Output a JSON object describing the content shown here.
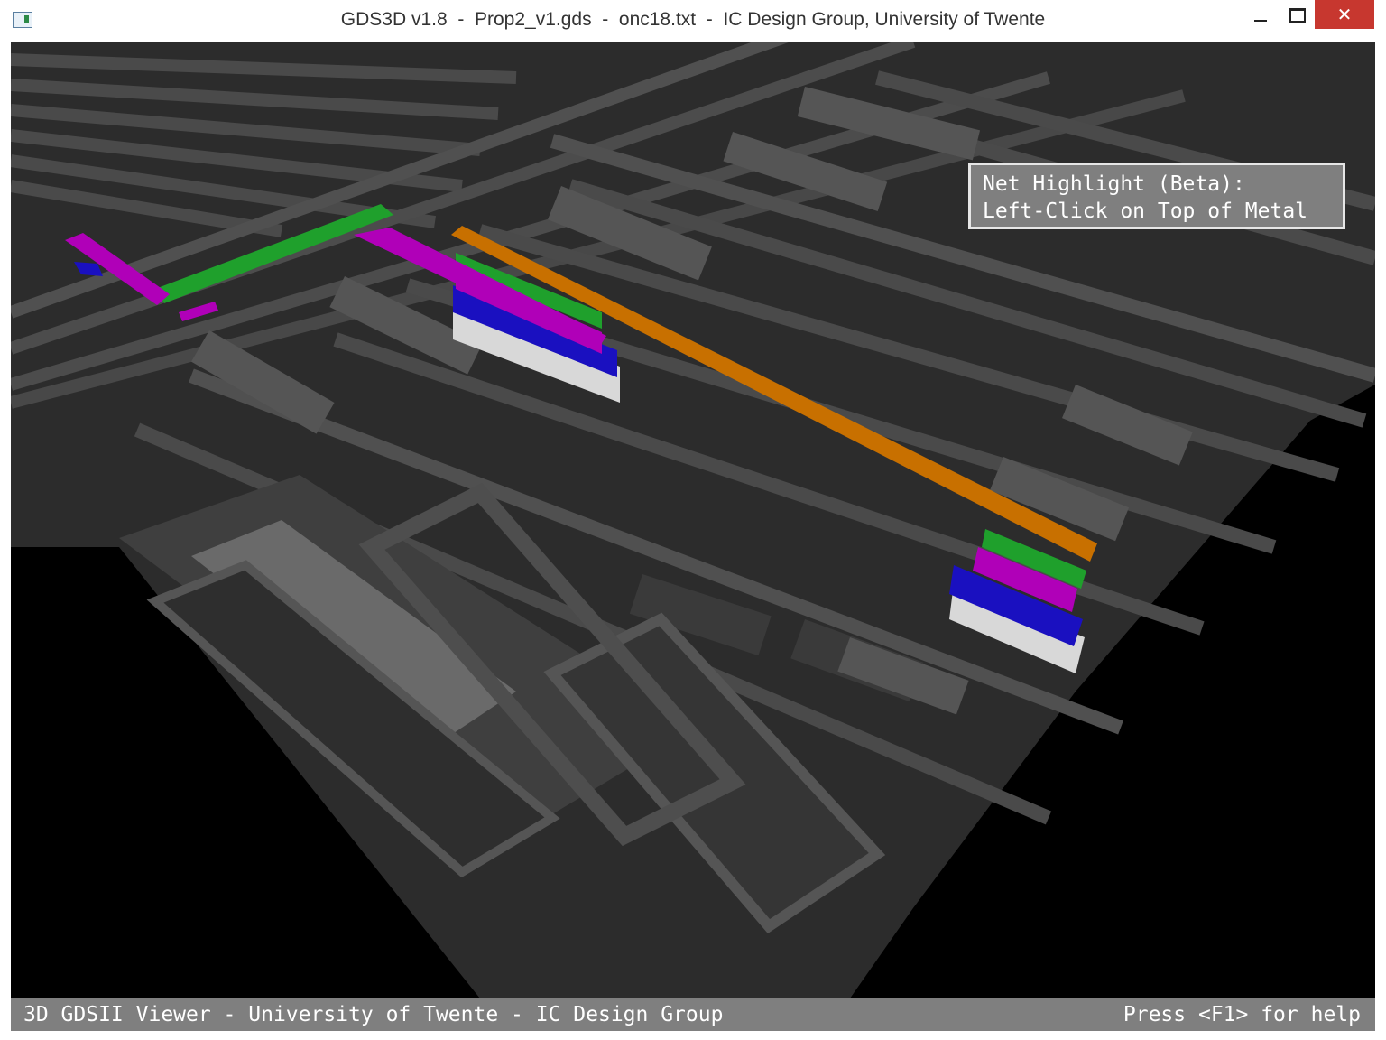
{
  "window": {
    "title": "GDS3D v1.8  -  Prop2_v1.gds  -  onc18.txt  -  IC Design Group, University of Twente",
    "minimize_icon": "minimize-icon",
    "maximize_icon": "maximize-icon",
    "close_glyph": "✕",
    "close_color": "#c7372f"
  },
  "overlay": {
    "line1": "Net Highlight (Beta):",
    "line2": "Left-Click on Top of Metal"
  },
  "statusbar": {
    "left": "3D GDSII Viewer - University of Twente - IC Design Group",
    "right": "Press <F1> for help"
  },
  "colors": {
    "background": "#000000",
    "highlight_orange": "#c87000",
    "highlight_green": "#1fa02c",
    "highlight_magenta": "#b000b8",
    "highlight_blue": "#1a10c0",
    "highlight_white": "#d8d8d8"
  }
}
